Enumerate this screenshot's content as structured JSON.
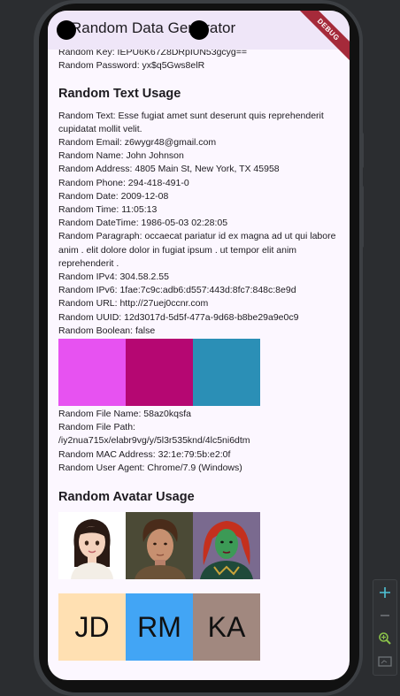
{
  "app": {
    "title": "Random Data Generator",
    "debug_label": "DEBUG"
  },
  "top": {
    "key_line": "Random Key: IEPU6K67Z8DRpIUN53gcyg==",
    "password_line": "Random Password: yx$q5Gws8elR"
  },
  "text_section": {
    "title": "Random Text Usage",
    "text_line": "Random Text: Esse fugiat amet sunt deserunt quis reprehenderit cupidatat mollit velit.",
    "email_line": "Random Email: z6wygr48@gmail.com",
    "name_line": "Random Name: John Johnson",
    "address_line": "Random Address: 4805 Main St, New York, TX 45958",
    "phone_line": "Random Phone: 294-418-491-0",
    "date_line": "Random Date: 2009-12-08",
    "time_line": "Random Time: 11:05:13",
    "datetime_line": "Random DateTime: 1986-05-03 02:28:05",
    "paragraph_line": "Random Paragraph: occaecat pariatur id ex magna ad ut qui labore anim . elit dolore dolor in fugiat ipsum . ut tempor elit anim reprehenderit .",
    "ipv4_line": "Random IPv4: 304.58.2.55",
    "ipv6_line": "Random IPv6: 1fae:7c9c:adb6:d557:443d:8fc7:848c:8e9d",
    "url_line": "Random URL: http://27uej0ccnr.com",
    "uuid_line": "Random UUID: 12d3017d-5d5f-477a-9d68-b8be29a9e0c9",
    "boolean_line": "Random Boolean: false",
    "colors": [
      "#e752f1",
      "#b50772",
      "#2b8fb6"
    ],
    "filename_line": "Random File Name: 58az0kqsfa",
    "filepath_line": "Random File Path: /iy2nua715x/elabr9vg/y/5l3r535knd/4lc5ni6dtm",
    "mac_line": "Random MAC Address: 32:1e:79:5b:e2:0f",
    "useragent_line": "Random User Agent: Chrome/7.9 (Windows)"
  },
  "avatar_section": {
    "title": "Random Avatar Usage",
    "photos": [
      "cartoon-girl-avatar",
      "young-man-portrait",
      "green-skinned-woman-portrait"
    ],
    "initials": [
      {
        "text": "JD",
        "color": "#ffe0b2"
      },
      {
        "text": "RM",
        "color": "#42a5f5"
      },
      {
        "text": "KA",
        "color": "#a1887f"
      }
    ]
  },
  "zoom_controls": [
    "zoom-in-icon",
    "zoom-out-icon",
    "zoom-fit-icon",
    "screen-icon"
  ]
}
